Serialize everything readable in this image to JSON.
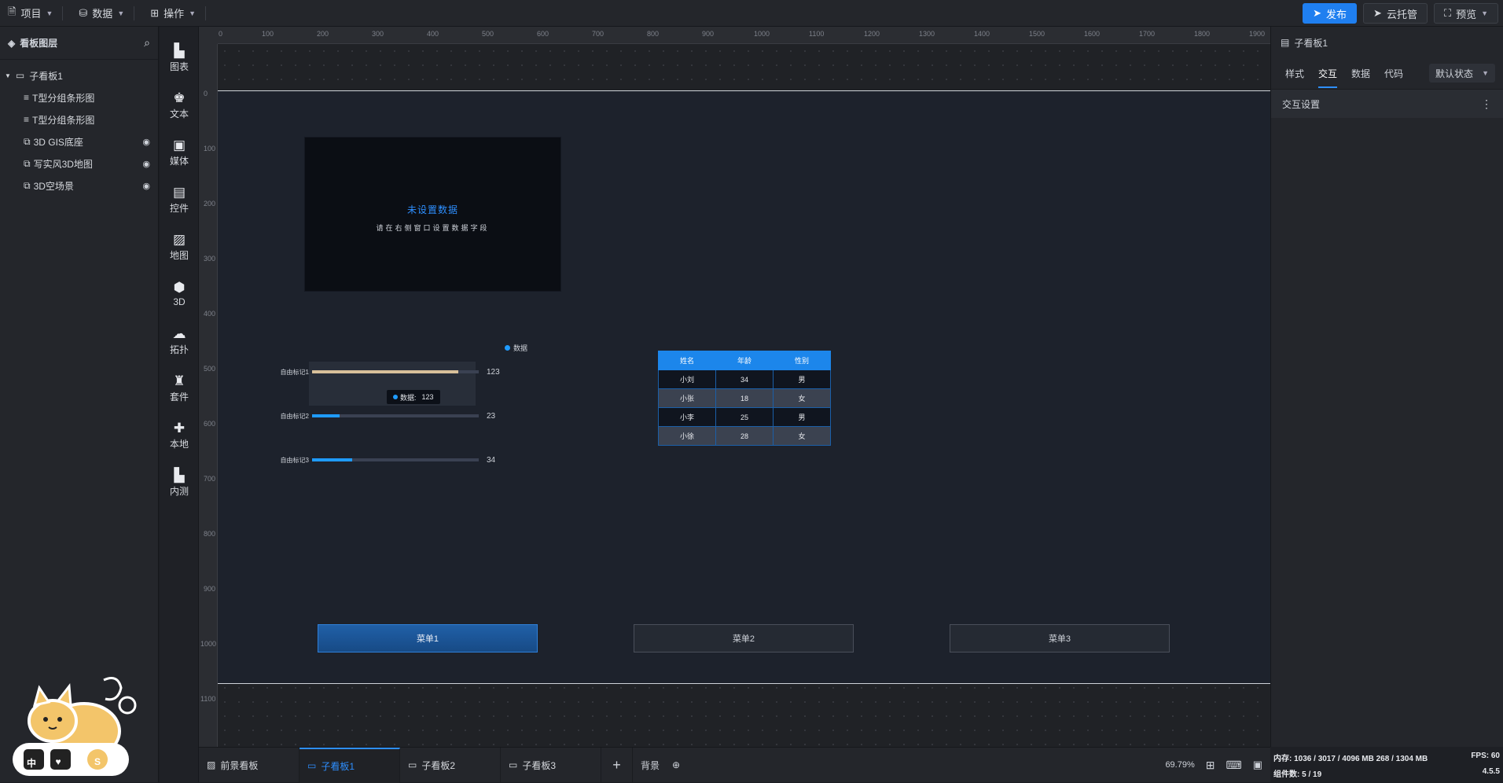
{
  "topbar": {
    "menus": [
      {
        "label": "项目",
        "icon": "file-icon"
      },
      {
        "label": "数据",
        "icon": "database-icon"
      },
      {
        "label": "操作",
        "icon": "grid-icon"
      }
    ],
    "publish_label": "发布",
    "cloud_label": "云托管",
    "preview_label": "预览"
  },
  "layers": {
    "title": "看板图层",
    "items": [
      {
        "label": "子看板1"
      },
      {
        "label": "T型分组条形图"
      },
      {
        "label": "T型分组条形图"
      },
      {
        "label": "3D GIS底座"
      },
      {
        "label": "写实风3D地图"
      },
      {
        "label": "3D空场景"
      }
    ],
    "mascot_keys": [
      "中",
      "♥",
      "S"
    ]
  },
  "toolbox": {
    "tools": [
      {
        "label": "图表",
        "icon": "chart-icon"
      },
      {
        "label": "文本",
        "icon": "text-icon"
      },
      {
        "label": "媒体",
        "icon": "media-icon"
      },
      {
        "label": "控件",
        "icon": "control-icon"
      },
      {
        "label": "地图",
        "icon": "map-icon"
      },
      {
        "label": "3D",
        "icon": "cube-icon"
      },
      {
        "label": "拓扑",
        "icon": "topology-icon"
      },
      {
        "label": "套件",
        "icon": "shirt-icon"
      },
      {
        "label": "本地",
        "icon": "puzzle-icon"
      },
      {
        "label": "内测",
        "icon": "beta-chart-icon"
      }
    ]
  },
  "rulers": {
    "top": [
      "0",
      "100",
      "200",
      "300",
      "400",
      "500",
      "600",
      "700",
      "800",
      "900",
      "1000",
      "1100",
      "1200",
      "1300",
      "1400",
      "1500",
      "1600",
      "1700",
      "1800",
      "1900"
    ],
    "left": [
      "0",
      "100",
      "200",
      "300",
      "400",
      "500",
      "600",
      "700",
      "800",
      "900",
      "1000",
      "1100"
    ]
  },
  "empty_chart": {
    "title": "未设置数据",
    "subtitle": "请在右侧窗口设置数据字段"
  },
  "bar_chart": {
    "legend": "数据",
    "tooltip_label": "数据:",
    "tooltip_value": "123"
  },
  "chart_data": {
    "type": "bar",
    "categories": [
      "自由标记1",
      "自由标记2",
      "自由标记3"
    ],
    "series": [
      {
        "name": "数据",
        "values": [
          123,
          23,
          34
        ]
      }
    ],
    "xlim": [
      0,
      140
    ],
    "colors": {
      "highlight": "#d8c09a",
      "normal": "#1f9bff"
    }
  },
  "table": {
    "headers": [
      "姓名",
      "年龄",
      "性别"
    ],
    "rows": [
      [
        "小刘",
        "34",
        "男"
      ],
      [
        "小张",
        "18",
        "女"
      ],
      [
        "小李",
        "25",
        "男"
      ],
      [
        "小徐",
        "28",
        "女"
      ]
    ]
  },
  "menu_buttons": [
    {
      "label": "菜单1",
      "active": true
    },
    {
      "label": "菜单2",
      "active": false
    },
    {
      "label": "菜单3",
      "active": false
    }
  ],
  "bottom_tabs": {
    "tabs": [
      {
        "label": "前景看板",
        "active": false
      },
      {
        "label": "子看板1",
        "active": true
      },
      {
        "label": "子看板2",
        "active": false
      },
      {
        "label": "子看板3",
        "active": false
      }
    ],
    "background_label": "背景",
    "zoom": "69.79%"
  },
  "right_panel": {
    "title": "子看板1",
    "tabs": [
      "样式",
      "交互",
      "数据",
      "代码"
    ],
    "active_tab": "交互",
    "state_select": "默认状态",
    "section_title": "交互设置"
  },
  "status": {
    "memory": "内存: 1036 / 3017 / 4096 MB  268 / 1304 MB",
    "fps": "FPS: 60",
    "components": "组件数: 5 / 19",
    "version": "4.5.5"
  },
  "colors": {
    "accent": "#1f7ff0",
    "table_header": "#1c86eb"
  }
}
